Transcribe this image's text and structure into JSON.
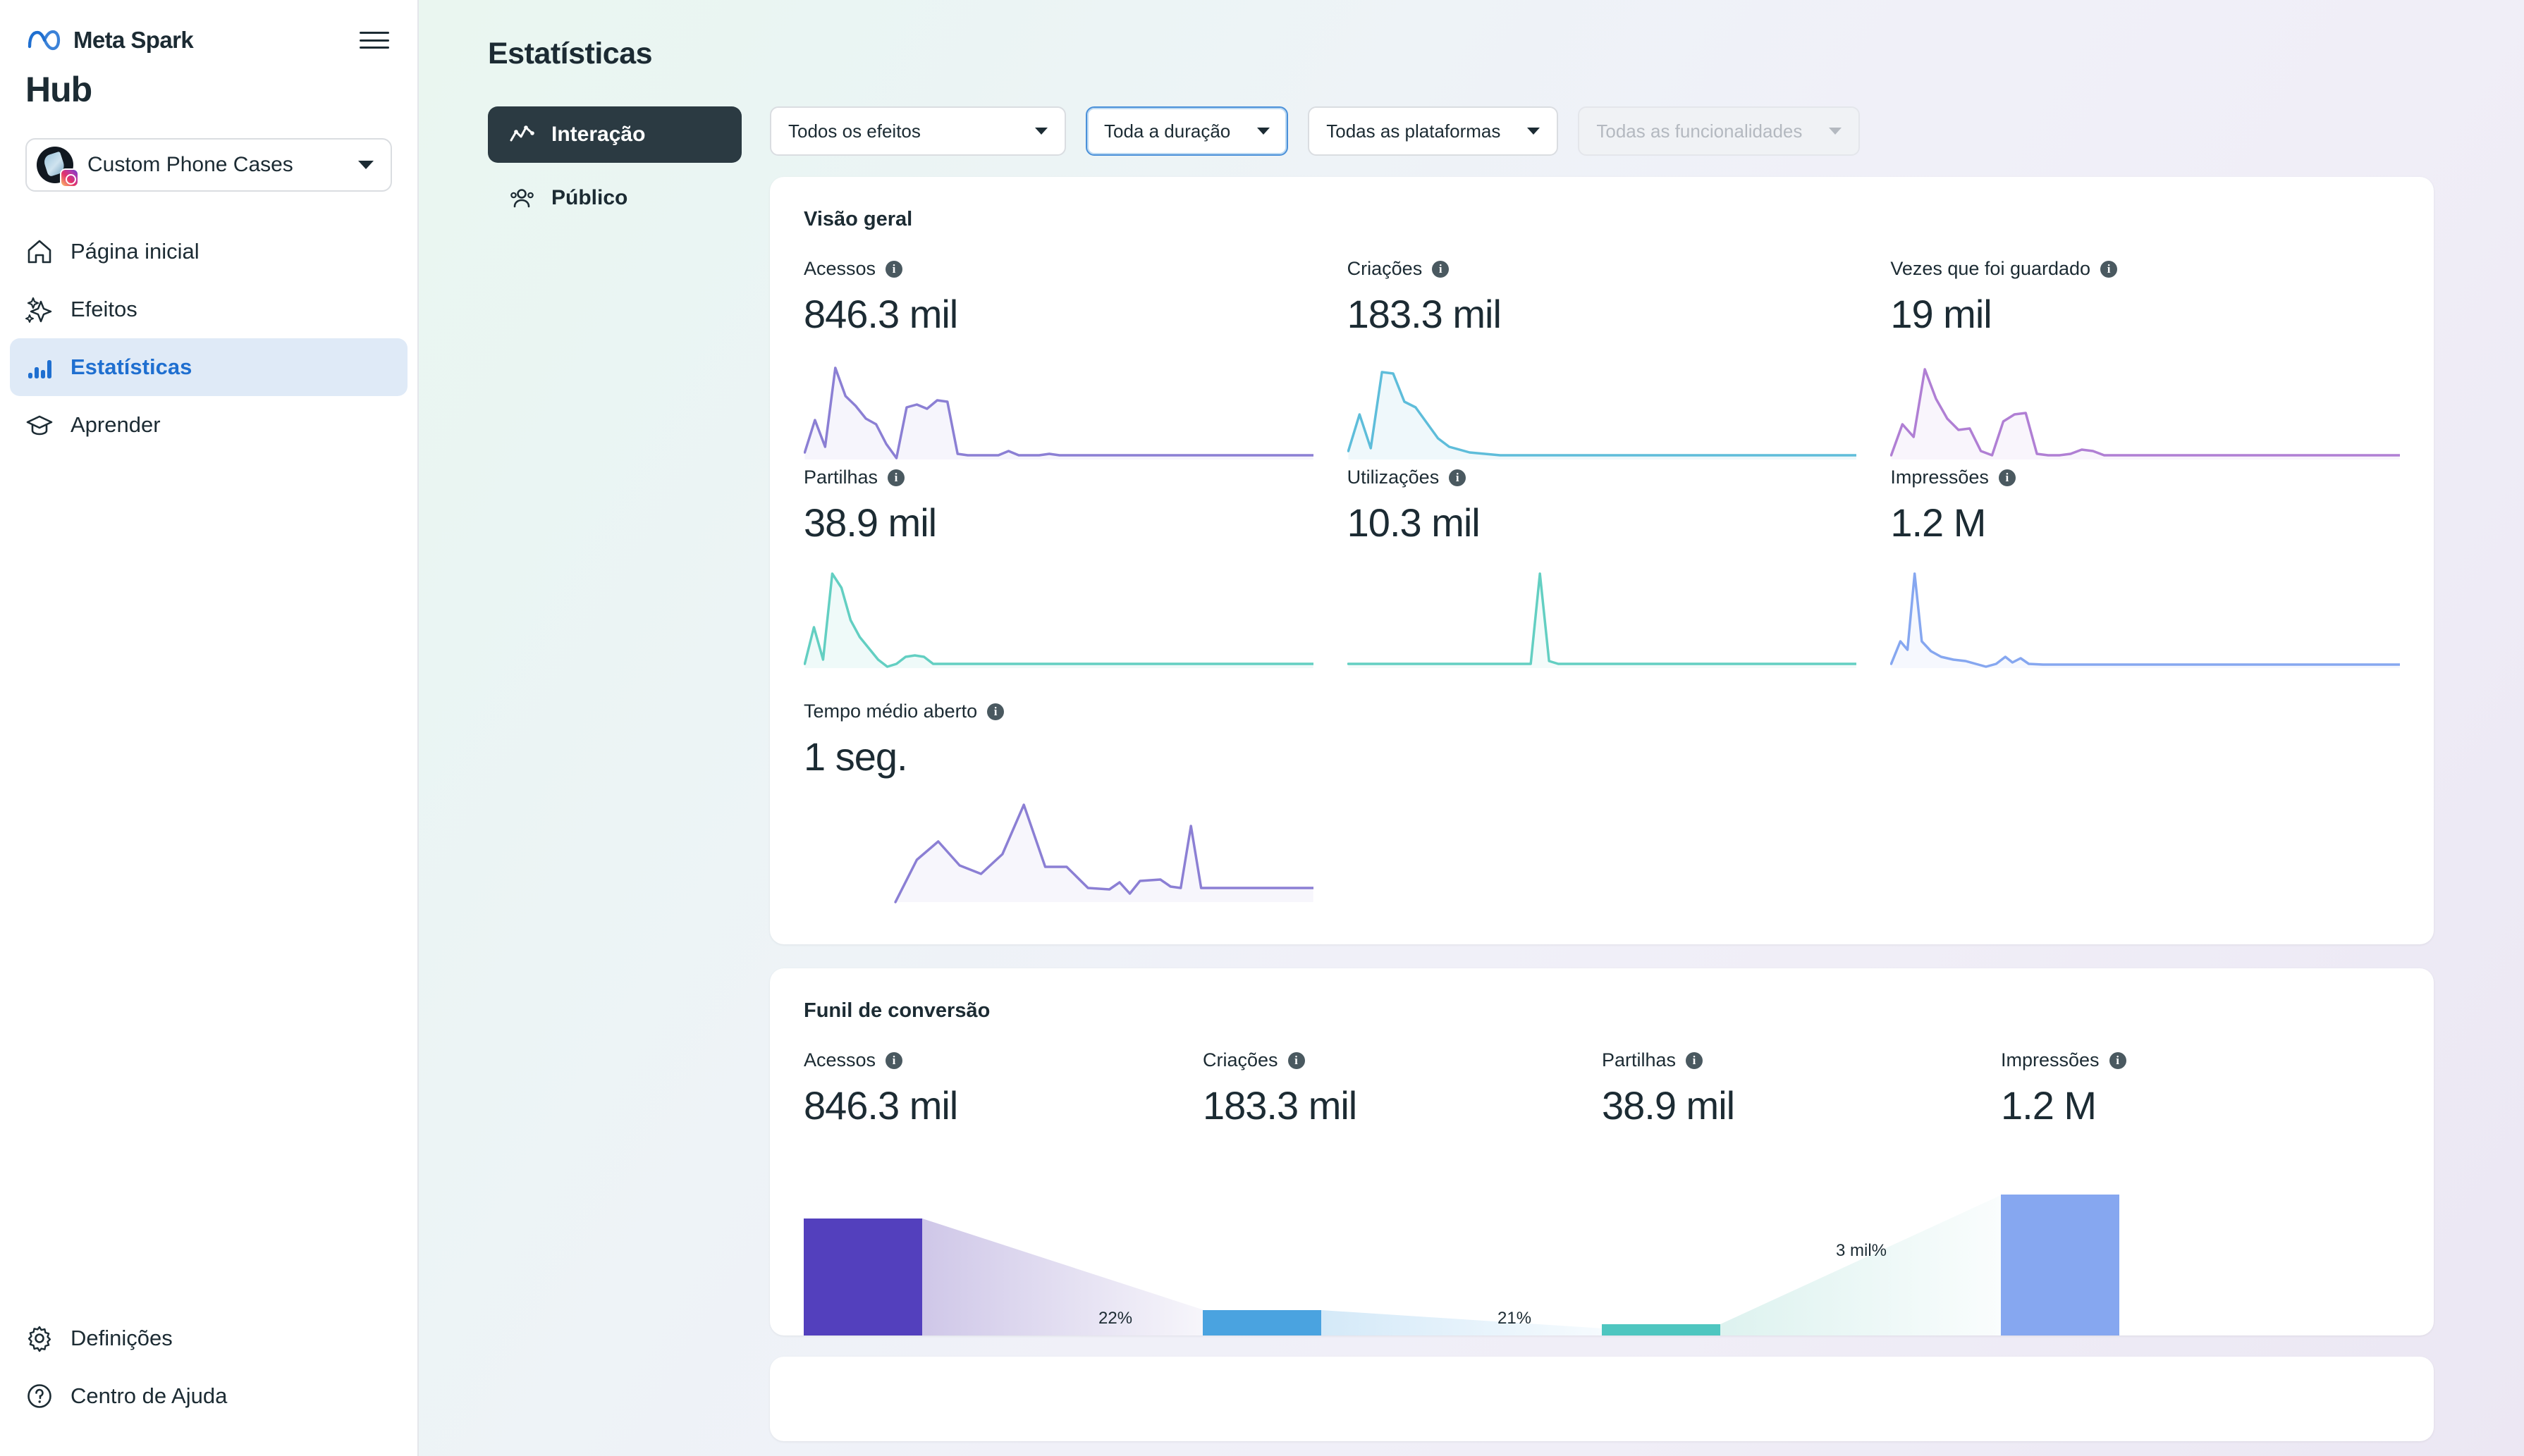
{
  "sidebar": {
    "brand": "Meta Spark",
    "hub_title": "Hub",
    "menu_icon": "hamburger-icon",
    "account": {
      "name": "Custom Phone Cases",
      "caret": "chevron-down-icon"
    },
    "items": [
      {
        "label": "Página inicial",
        "icon": "home-icon",
        "active": false
      },
      {
        "label": "Efeitos",
        "icon": "sparkles-icon",
        "active": false
      },
      {
        "label": "Estatísticas",
        "icon": "bar-chart-icon",
        "active": true
      },
      {
        "label": "Aprender",
        "icon": "graduation-cap-icon",
        "active": false
      }
    ],
    "bottom_items": [
      {
        "label": "Definições",
        "icon": "gear-icon"
      },
      {
        "label": "Centro de Ajuda",
        "icon": "help-circle-icon"
      }
    ]
  },
  "header": {
    "title": "Estatísticas"
  },
  "tabs": [
    {
      "label": "Interação",
      "icon": "line-chart-icon",
      "active": true
    },
    {
      "label": "Público",
      "icon": "people-icon",
      "active": false
    }
  ],
  "filters": [
    {
      "label": "Todos os efeitos",
      "state": "default"
    },
    {
      "label": "Toda a duração",
      "state": "focused"
    },
    {
      "label": "Todas as plataformas",
      "state": "default"
    },
    {
      "label": "Todas as funcionalidades",
      "state": "disabled"
    }
  ],
  "overview": {
    "title": "Visão geral",
    "metrics": [
      {
        "label": "Acessos",
        "value": "846.3 mil",
        "color": "#8b7fd4"
      },
      {
        "label": "Criações",
        "value": "183.3 mil",
        "color": "#5ebdda"
      },
      {
        "label": "Vezes que foi guardado",
        "value": "19 mil",
        "color": "#b07fd4"
      },
      {
        "label": "Partilhas",
        "value": "38.9 mil",
        "color": "#63cfc2"
      },
      {
        "label": "Utilizações",
        "value": "10.3 mil",
        "color": "#63cfc2"
      },
      {
        "label": "Impressões",
        "value": "1.2 M",
        "color": "#86a7f0"
      },
      {
        "label": "Tempo médio aberto",
        "value": "1 seg.",
        "color": "#8b7fd4"
      }
    ]
  },
  "funnel": {
    "title": "Funil de conversão",
    "steps": [
      {
        "label": "Acessos",
        "value": "846.3 mil",
        "bar_color": "#5340bd",
        "bar_height_pct": 100,
        "rate": "22%"
      },
      {
        "label": "Criações",
        "value": "183.3 mil",
        "bar_color": "#4aa3e0",
        "bar_height_pct": 22,
        "rate": "21%"
      },
      {
        "label": "Partilhas",
        "value": "38.9 mil",
        "bar_color": "#4ec6c0",
        "bar_height_pct": 5,
        "rate": "3 mil%"
      },
      {
        "label": "Impressões",
        "value": "1.2 M",
        "bar_color": "#86a7f0",
        "bar_height_pct": 140,
        "rate": ""
      }
    ]
  },
  "chart_data": [
    {
      "type": "line",
      "title": "Acessos",
      "series": [
        {
          "name": "Acessos",
          "values": [
            8,
            34,
            12,
            96,
            62,
            52,
            40,
            36,
            18,
            4,
            40,
            42,
            38,
            46,
            44,
            8,
            6,
            6,
            6,
            6,
            10,
            6,
            6,
            6,
            8,
            6,
            6,
            6,
            6,
            6
          ]
        }
      ],
      "ylabel": "",
      "xlabel": "",
      "grid": false
    },
    {
      "type": "line",
      "title": "Criações",
      "series": [
        {
          "name": "Criações",
          "values": [
            10,
            34,
            10,
            88,
            86,
            62,
            58,
            40,
            22,
            14,
            12,
            10,
            8,
            8,
            8,
            8,
            8,
            8,
            8,
            8,
            8,
            8,
            8,
            8,
            8,
            8,
            8,
            8,
            8,
            8
          ]
        }
      ],
      "ylabel": "",
      "xlabel": "",
      "grid": false
    },
    {
      "type": "line",
      "title": "Vezes que foi guardado",
      "series": [
        {
          "name": "Guardados",
          "values": [
            6,
            34,
            22,
            96,
            66,
            44,
            34,
            30,
            30,
            10,
            6,
            36,
            46,
            48,
            48,
            8,
            8,
            8,
            10,
            14,
            12,
            6,
            6,
            6,
            6,
            6,
            6,
            6,
            6,
            6
          ]
        }
      ],
      "ylabel": "",
      "xlabel": "",
      "grid": false
    },
    {
      "type": "line",
      "title": "Partilhas",
      "series": [
        {
          "name": "Partilhas",
          "values": [
            6,
            42,
            10,
            98,
            78,
            46,
            32,
            22,
            12,
            4,
            10,
            14,
            14,
            12,
            6,
            6,
            6,
            6,
            6,
            6,
            6,
            6,
            6,
            6,
            6,
            6,
            6,
            6,
            6,
            6
          ]
        }
      ],
      "ylabel": "",
      "xlabel": "",
      "grid": false
    },
    {
      "type": "line",
      "title": "Utilizações",
      "series": [
        {
          "name": "Utilizações",
          "values": [
            4,
            4,
            4,
            4,
            4,
            4,
            4,
            4,
            4,
            4,
            4,
            4,
            4,
            4,
            4,
            4,
            4,
            98,
            10,
            6,
            6,
            6,
            6,
            6,
            6,
            6,
            6,
            6,
            6,
            6
          ]
        }
      ],
      "ylabel": "",
      "xlabel": "",
      "grid": false
    },
    {
      "type": "line",
      "title": "Impressões",
      "series": [
        {
          "name": "Impressões",
          "values": [
            6,
            24,
            14,
            98,
            30,
            18,
            12,
            10,
            8,
            6,
            14,
            10,
            20,
            10,
            8,
            8,
            8,
            8,
            8,
            8,
            8,
            8,
            8,
            8,
            8,
            8,
            8,
            8,
            8,
            8
          ]
        }
      ],
      "ylabel": "",
      "xlabel": "",
      "grid": false
    },
    {
      "type": "line",
      "title": "Tempo médio aberto",
      "series": [
        {
          "name": "Tempo médio aberto",
          "values": [
            4,
            30,
            52,
            44,
            34,
            40,
            96,
            44,
            30,
            30,
            12,
            12,
            18,
            8,
            18,
            22,
            22,
            14,
            14,
            78,
            14,
            14,
            14,
            14
          ]
        }
      ],
      "ylabel": "",
      "xlabel": "",
      "grid": false
    },
    {
      "type": "bar",
      "title": "Funil de conversão",
      "categories": [
        "Acessos",
        "Criações",
        "Partilhas",
        "Impressões"
      ],
      "values": [
        846300,
        183300,
        38900,
        1200000
      ],
      "value_labels": [
        "846.3 mil",
        "183.3 mil",
        "38.9 mil",
        "1.2 M"
      ],
      "conversion_rates": [
        "22%",
        "21%",
        "3 mil%"
      ],
      "colors": [
        "#5340bd",
        "#4aa3e0",
        "#4ec6c0",
        "#86a7f0"
      ],
      "xlabel": "",
      "ylabel": "",
      "grid": false
    }
  ]
}
